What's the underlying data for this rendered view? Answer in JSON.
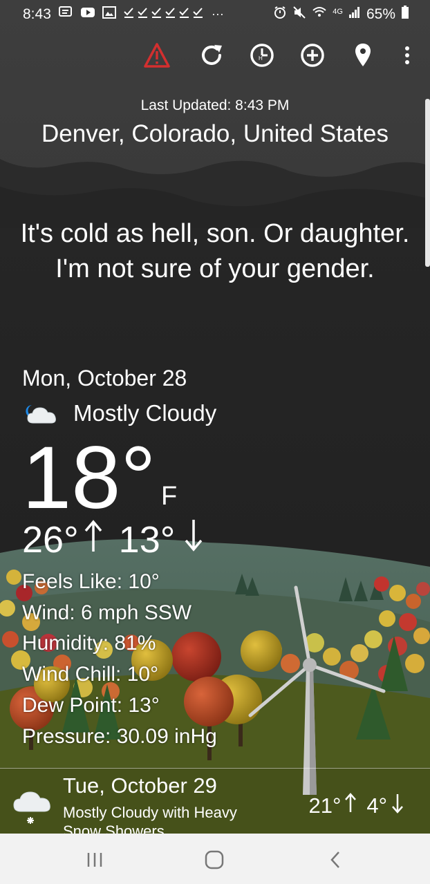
{
  "status_bar": {
    "time": "8:43",
    "overflow": "···",
    "network": "4G",
    "battery": "65%"
  },
  "toolbar": {
    "icons": [
      "alert-icon",
      "refresh-icon",
      "hourly-icon",
      "add-location-icon",
      "location-pin-icon",
      "more-vert-icon"
    ]
  },
  "header": {
    "last_updated": "Last Updated: 8:43 PM",
    "location": "Denver, Colorado, United States"
  },
  "quote": "It's cold as hell, son. Or daughter. I'm not sure of your gender.",
  "today": {
    "date": "Mon, October 28",
    "condition": "Mostly Cloudy",
    "temp": "18°",
    "unit": "F",
    "high": "26°",
    "low": "13°"
  },
  "details": [
    "Feels Like: 10°",
    "Wind: 6 mph SSW",
    "Humidity: 81%",
    "Wind Chill: 10°",
    "Dew Point: 13°",
    "Pressure: 30.09 inHg"
  ],
  "forecast": {
    "date": "Tue, October 29",
    "condition_line1": "Mostly Cloudy with Heavy",
    "condition_line2": "Snow Showers",
    "high": "21°",
    "low": "4°"
  },
  "colors": {
    "alert": "#d32f2f",
    "sky_top": "#3c3c3c",
    "sky_dark": "#232323",
    "hills": "#556e62",
    "grass": "#4e5a1c",
    "navbar": "#f2f2f2"
  }
}
